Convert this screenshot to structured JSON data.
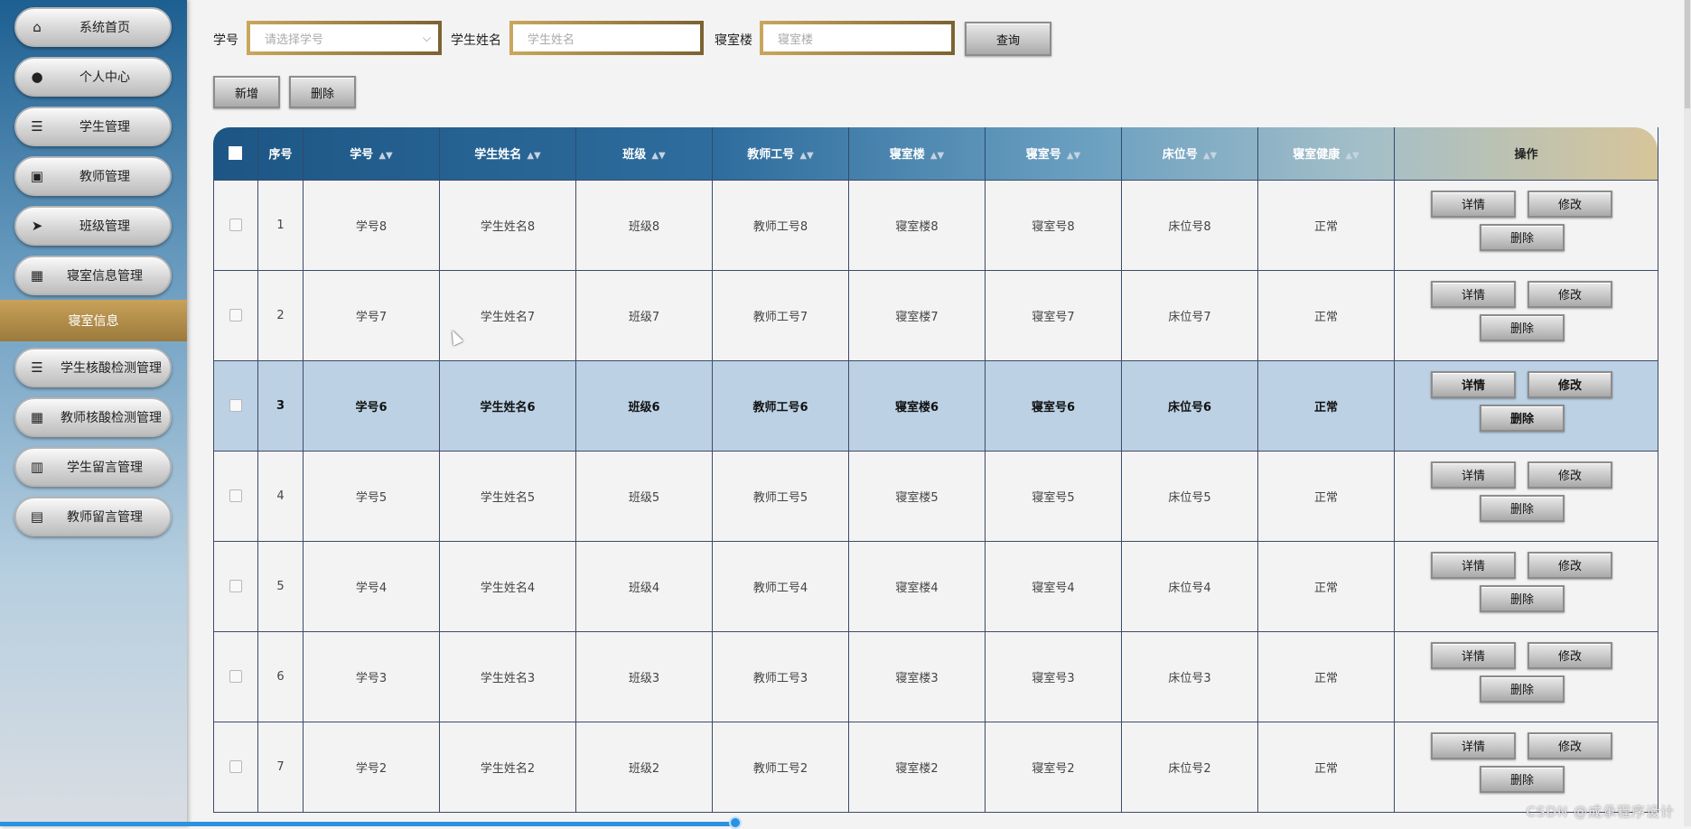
{
  "sidebar": {
    "items": [
      {
        "label": "系统首页",
        "icon": "home-icon",
        "glyph": "⌂"
      },
      {
        "label": "个人中心",
        "icon": "user-icon",
        "glyph": "●"
      },
      {
        "label": "学生管理",
        "icon": "list-icon",
        "glyph": "☰"
      },
      {
        "label": "教师管理",
        "icon": "briefcase-icon",
        "glyph": "▣"
      },
      {
        "label": "班级管理",
        "icon": "send-icon",
        "glyph": "➤"
      },
      {
        "label": "寝室信息管理",
        "icon": "grid-icon",
        "glyph": "▦"
      },
      {
        "label": "学生核酸检测管理",
        "icon": "list-icon",
        "glyph": "☰"
      },
      {
        "label": "教师核酸检测管理",
        "icon": "grid-icon",
        "glyph": "▦"
      },
      {
        "label": "学生留言管理",
        "icon": "book-icon",
        "glyph": "▥"
      },
      {
        "label": "教师留言管理",
        "icon": "clipboard-icon",
        "glyph": "▤"
      }
    ],
    "sub_item": "寝室信息"
  },
  "search": {
    "xuehao_label": "学号",
    "xuehao_placeholder": "请选择学号",
    "name_label": "学生姓名",
    "name_placeholder": "学生姓名",
    "building_label": "寝室楼",
    "building_placeholder": "寝室楼",
    "query_button": "查询"
  },
  "actions": {
    "add": "新增",
    "delete": "删除"
  },
  "table": {
    "headers": [
      "序号",
      "学号",
      "学生姓名",
      "班级",
      "教师工号",
      "寝室楼",
      "寝室号",
      "床位号",
      "寝室健康",
      "操作"
    ],
    "rows": [
      {
        "idx": "1",
        "xuehao": "学号8",
        "name": "学生姓名8",
        "banji": "班级8",
        "gonghao": "教师工号8",
        "lou": "寝室楼8",
        "hao": "寝室号8",
        "chuang": "床位号8",
        "health": "正常"
      },
      {
        "idx": "2",
        "xuehao": "学号7",
        "name": "学生姓名7",
        "banji": "班级7",
        "gonghao": "教师工号7",
        "lou": "寝室楼7",
        "hao": "寝室号7",
        "chuang": "床位号7",
        "health": "正常"
      },
      {
        "idx": "3",
        "xuehao": "学号6",
        "name": "学生姓名6",
        "banji": "班级6",
        "gonghao": "教师工号6",
        "lou": "寝室楼6",
        "hao": "寝室号6",
        "chuang": "床位号6",
        "health": "正常"
      },
      {
        "idx": "4",
        "xuehao": "学号5",
        "name": "学生姓名5",
        "banji": "班级5",
        "gonghao": "教师工号5",
        "lou": "寝室楼5",
        "hao": "寝室号5",
        "chuang": "床位号5",
        "health": "正常"
      },
      {
        "idx": "5",
        "xuehao": "学号4",
        "name": "学生姓名4",
        "banji": "班级4",
        "gonghao": "教师工号4",
        "lou": "寝室楼4",
        "hao": "寝室号4",
        "chuang": "床位号4",
        "health": "正常"
      },
      {
        "idx": "6",
        "xuehao": "学号3",
        "name": "学生姓名3",
        "banji": "班级3",
        "gonghao": "教师工号3",
        "lou": "寝室楼3",
        "hao": "寝室号3",
        "chuang": "床位号3",
        "health": "正常"
      },
      {
        "idx": "7",
        "xuehao": "学号2",
        "name": "学生姓名2",
        "banji": "班级2",
        "gonghao": "教师工号2",
        "lou": "寝室楼2",
        "hao": "寝室号2",
        "chuang": "床位号2",
        "health": "正常"
      }
    ],
    "row_buttons": {
      "detail": "详情",
      "edit": "修改",
      "delete": "删除"
    }
  },
  "watermark": "CSDN @成承程序设计",
  "colors": {
    "accent_gold": "#a4844a",
    "header_blue": "#1d5685",
    "selected_row": "#bcd1e4"
  }
}
